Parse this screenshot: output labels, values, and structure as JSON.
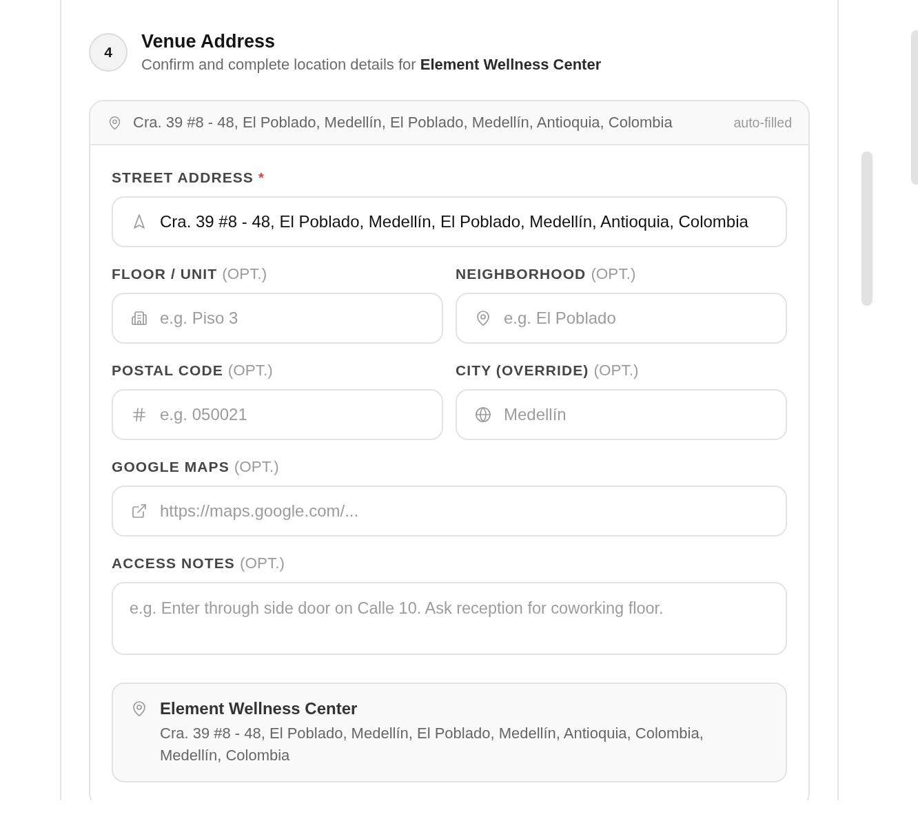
{
  "step": {
    "number": "4",
    "title": "Venue Address",
    "subtitle": "Confirm and complete location details for **Element Wellness Center**"
  },
  "autofill": {
    "address": "Cra. 39 #8 - 48, El Poblado, Medellín, El Poblado, Medellín, Antioquia, Colombia",
    "badge": "auto-filled"
  },
  "form": {
    "rows": [
      [
        {
          "kind": "text",
          "label": "STREET ADDRESS",
          "required_mark": "*",
          "value": "Cra. 39 #8 - 48, El Poblado, Medellín, El Poblado, Medellín, Antioquia, Colombia"
        }
      ],
      [
        {
          "kind": "text",
          "label": "FLOOR / UNIT",
          "optional_tag": "(OPT.)",
          "placeholder": "e.g. Piso 3"
        },
        {
          "kind": "text",
          "label": "NEIGHBORHOOD",
          "optional_tag": "(OPT.)",
          "placeholder": "e.g. El Poblado"
        }
      ],
      [
        {
          "kind": "text",
          "label": "POSTAL CODE",
          "optional_tag": "(OPT.)",
          "placeholder": "e.g. 050021"
        },
        {
          "kind": "text",
          "label": "CITY (OVERRIDE)",
          "optional_tag": "(OPT.)",
          "placeholder": "Medellín"
        }
      ],
      [
        {
          "kind": "text",
          "label": "GOOGLE MAPS",
          "optional_tag": "(OPT.)",
          "placeholder": "https://maps.google.com/..."
        }
      ],
      [
        {
          "kind": "textarea",
          "label": "ACCESS NOTES",
          "optional_tag": "(OPT.)",
          "placeholder": "e.g. Enter through side door on Calle 10. Ask reception for coworking floor."
        }
      ]
    ]
  },
  "summary": {
    "name": "Element Wellness Center",
    "address": "Cra. 39 #8 - 48, El Poblado, Medellín, El Poblado, Medellín, Antioquia, Colombia, Medellín, Colombia"
  }
}
